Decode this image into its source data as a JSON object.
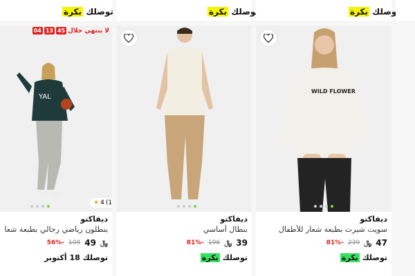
{
  "top_row": [
    {
      "delivery_prefix": "توصلك",
      "delivery_day": "بكرة"
    },
    {
      "delivery_prefix": "توصلك",
      "delivery_day": "بكرة"
    },
    {
      "delivery_prefix": "توصلك",
      "delivery_day": "بكرة"
    }
  ],
  "products": [
    {
      "brand": "ديفاكتو",
      "title": "سويت شيرت بطبعة شعار للأطفال",
      "price": "47",
      "currency": "﷼",
      "old_price": "239",
      "discount": "-81%",
      "delivery_prefix": "توصلك",
      "delivery_day": "بكرة",
      "image_dots": 4,
      "image_active_dot": 4,
      "icon": "heart-icon"
    },
    {
      "brand": "ديفاكتو",
      "title": "بنطال أساسي",
      "price": "39",
      "currency": "﷼",
      "old_price": "196",
      "discount": "-81%",
      "delivery_prefix": "توصلك",
      "delivery_day": "بكرة",
      "image_dots": 4,
      "image_active_dot": 4,
      "icon": "heart-icon"
    },
    {
      "brand": "ديفاكتو",
      "title": "بنطلون رياضي رجالي بطبعة شعار دي فاكتو",
      "price": "49",
      "currency": "﷼",
      "old_price": "109",
      "discount": "-56%",
      "delivery_prefix": "توصلك",
      "delivery_day": "18 أكتوبر",
      "rating": "4",
      "rating_count": "(1)",
      "timer_label": "لا ينتهي خلال",
      "timer": [
        "45",
        "13",
        "04"
      ],
      "image_dots": 4,
      "image_active_dot": 4
    }
  ],
  "colors": {
    "accent_yellow": "#f5f500",
    "accent_green": "#38e060",
    "discount_red": "#e02020"
  }
}
